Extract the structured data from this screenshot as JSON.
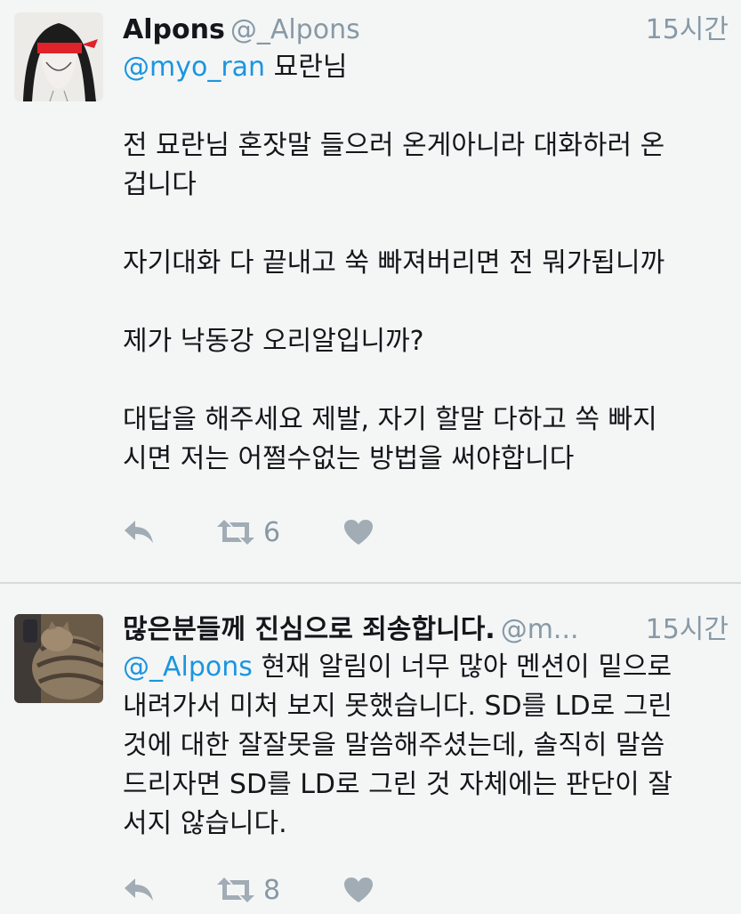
{
  "tweets": [
    {
      "name": "Alpons",
      "handle": "@_Alpons",
      "time": "15시간",
      "reply_mention": "@myo_ran",
      "reply_suffix": " 묘란님",
      "paragraphs": [
        [
          "전 묘란님 혼잣말 들으러 온게아니라 대화하러 온",
          "겁니다"
        ],
        [
          "자기대화 다 끝내고 쑥 빠져버리면 전 뭐가됩니까"
        ],
        [
          "제가 낙동강 오리알입니까?"
        ],
        [
          "대답을 해주세요 제발, 자기 할말 다하고 쏙 빠지",
          "시면 저는 어쩔수없는 방법을 써야합니다"
        ]
      ],
      "retweet_count": "6",
      "icons": {
        "reply": "reply-icon",
        "retweet": "retweet-icon",
        "like": "heart-icon"
      }
    },
    {
      "name": "많은분들께 진심으로 죄송합니다.",
      "handle": "@m...",
      "time": "15시간",
      "reply_mention": "@_Alpons",
      "lines": [
        " 현재 알림이 너무 많아 멘션이 밑으로",
        "내려가서 미처 보지 못했습니다. SD를 LD로 그린",
        "것에 대한 잘잘못을 말씀해주셨는데, 솔직히 말씀",
        "드리자면 SD를 LD로 그린 것 자체에는 판단이 잘",
        "서지 않습니다."
      ],
      "retweet_count": "8",
      "icons": {
        "reply": "reply-icon",
        "retweet": "retweet-icon",
        "like": "heart-icon"
      }
    }
  ],
  "colors": {
    "background": "#f4f6f6",
    "mention": "#1b95e0",
    "meta": "#8899a6",
    "icon": "#a1acb5",
    "divider": "#d6dadd"
  }
}
